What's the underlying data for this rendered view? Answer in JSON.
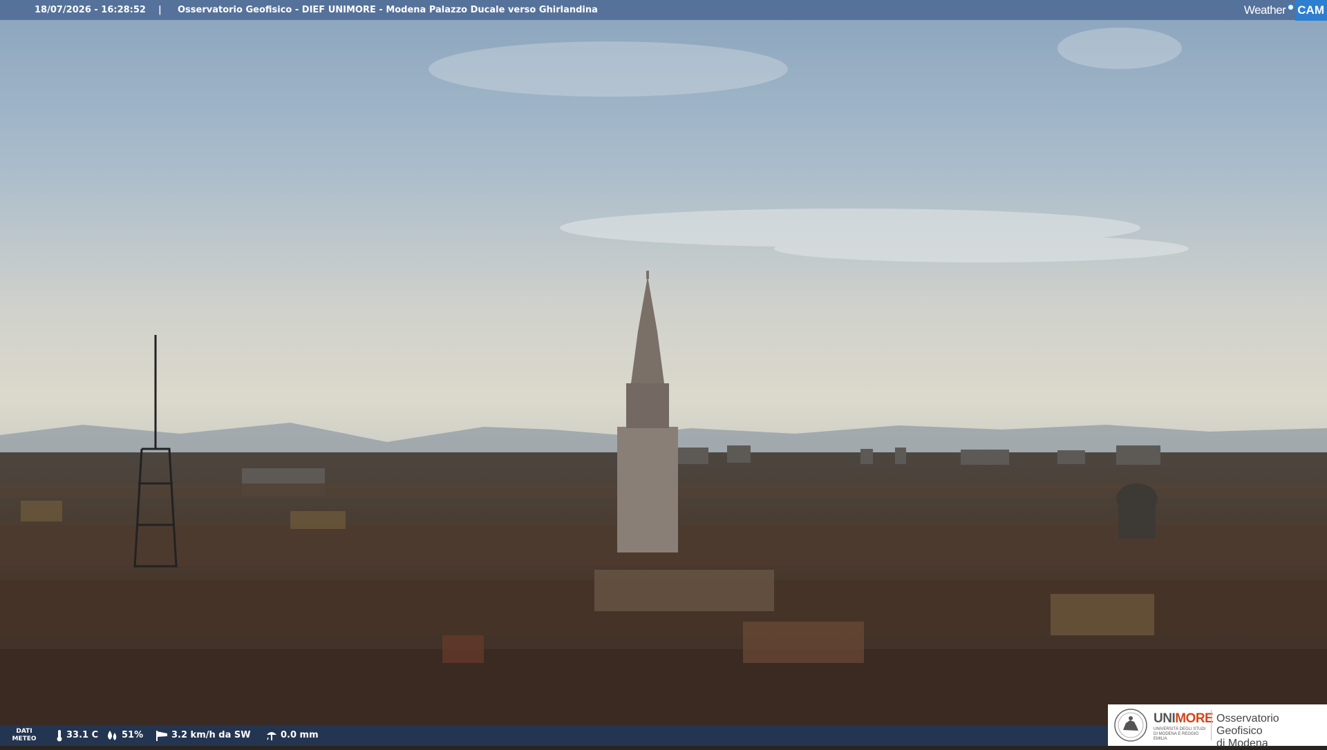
{
  "overlay": {
    "timestamp": "18/07/2026 - 16:28:52",
    "separator": "|",
    "title": "Osservatorio Geofisico - DIEF UNIMORE - Modena Palazzo Ducale verso Ghirlandina",
    "logo": {
      "weather": "Weather",
      "cam": "CAM"
    }
  },
  "meteo": {
    "label_line1": "DATI",
    "label_line2": "METEO",
    "temperature": "33.1 C",
    "humidity": "51%",
    "wind": "3.2 km/h da SW",
    "rain": "0.0 mm",
    "icons": [
      "thermometer-icon",
      "humidity-drops-icon",
      "wind-sock-icon",
      "rain-gauge-icon"
    ]
  },
  "branding": {
    "unimore_a": "UNI",
    "unimore_b": "MORE",
    "unimore_sub": "UNIVERSITÀ DEGLI STUDI DI MODENA E REGGIO EMILIA",
    "observatory_line1": "Osservatorio Geofisico",
    "observatory_line2": "di Modena"
  },
  "colors": {
    "overlay_bar": "#46648f",
    "weathercam_blue": "#2e7fd0",
    "unimore_orange": "#d2461b"
  }
}
